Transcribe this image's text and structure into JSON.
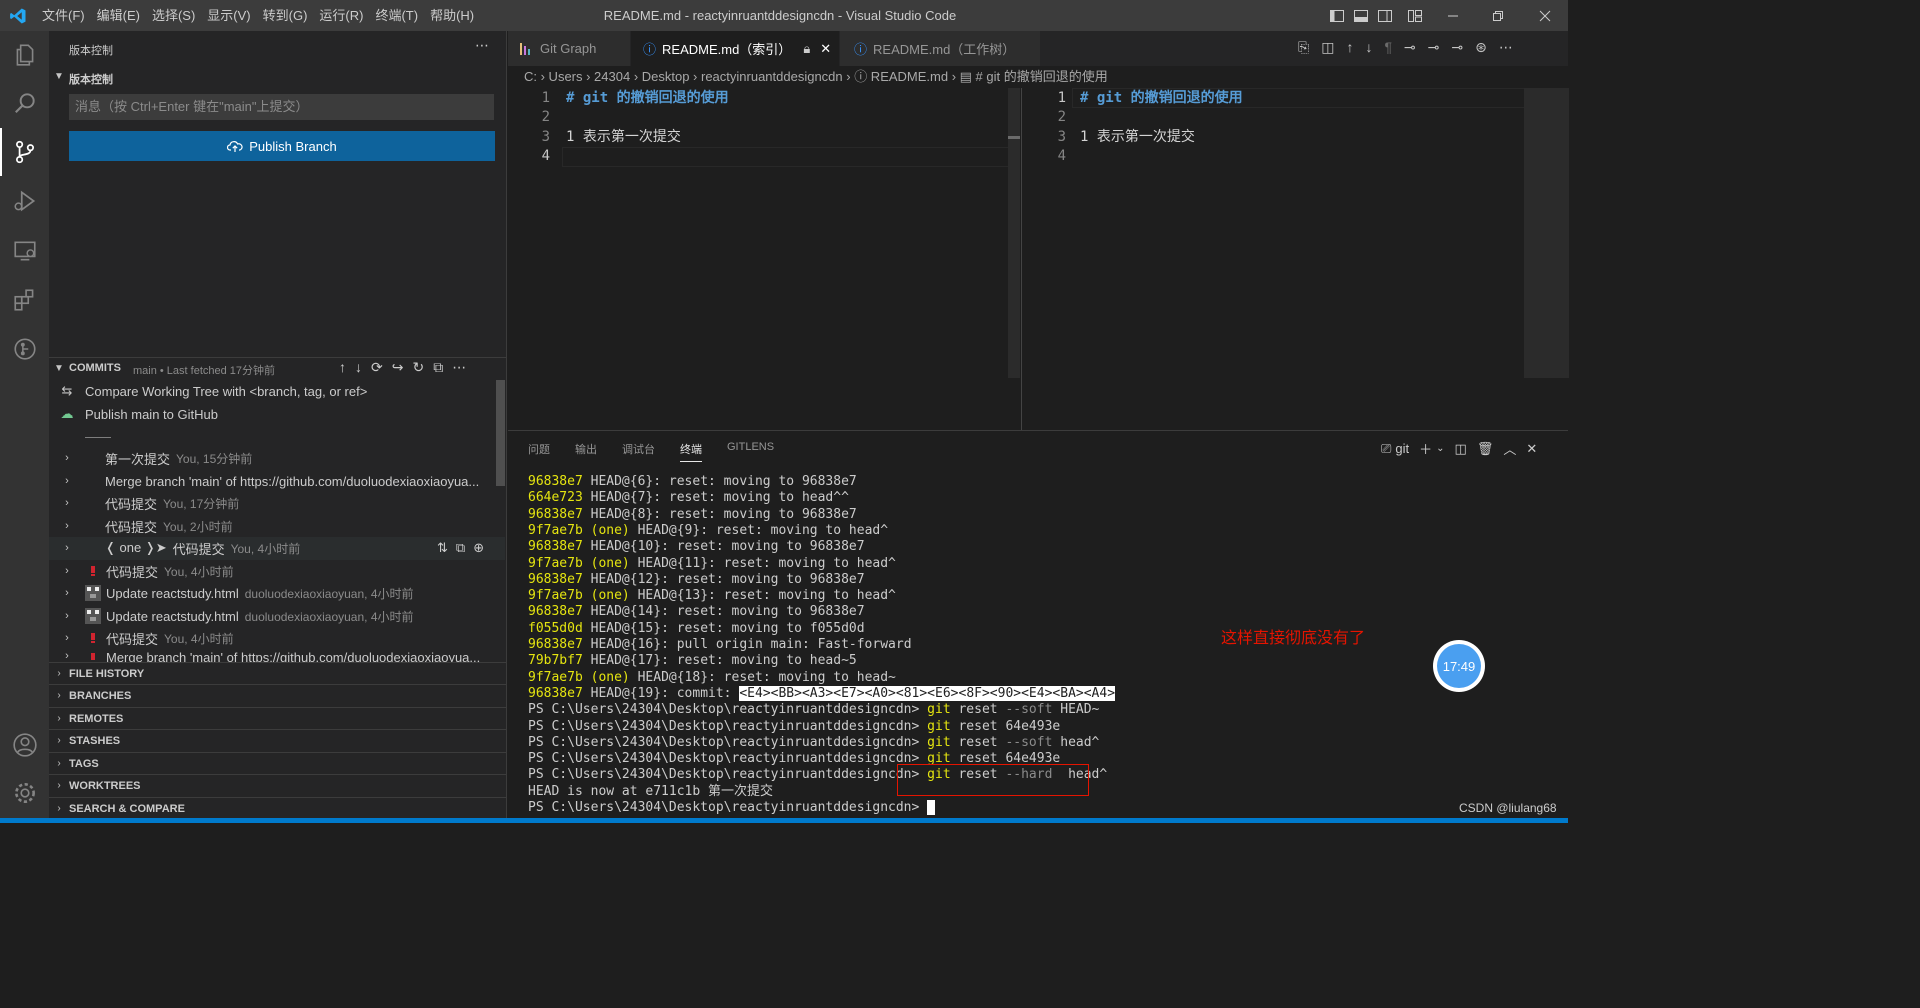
{
  "menu": [
    "文件(F)",
    "编辑(E)",
    "选择(S)",
    "显示(V)",
    "转到(G)",
    "运行(R)",
    "终端(T)",
    "帮助(H)"
  ],
  "window_title": "README.md - reactyinruantddesigncdn - Visual Studio Code",
  "sidebar": {
    "title": "版本控制",
    "section_title": "版本控制",
    "message_placeholder": "消息（按 Ctrl+Enter 键在\"main\"上提交）",
    "publish_label": "Publish Branch",
    "commits": {
      "header": "COMMITS",
      "subtitle": "main • Last fetched 17分钟前",
      "compare_label": "Compare Working Tree with <branch, tag, or ref>",
      "publish_main_label": "Publish main to GitHub",
      "divider": "——",
      "items": [
        {
          "label": "第一次提交",
          "meta": "You, 15分钟前",
          "avatar": "none"
        },
        {
          "label": "Merge branch 'main' of https://github.com/duoluodexiaoxiaoyua...",
          "meta": "",
          "avatar": "none"
        },
        {
          "label": "代码提交",
          "meta": "You, 17分钟前",
          "avatar": "none"
        },
        {
          "label": "代码提交",
          "meta": "You, 2小时前",
          "avatar": "none"
        },
        {
          "label": "代码提交",
          "meta": "You, 4小时前",
          "avatar": "none",
          "branch_tag": "❬ one ❭➤"
        },
        {
          "label": "代码提交",
          "meta": "You, 4小时前",
          "avatar": "red"
        },
        {
          "label": "Update reactstudy.html",
          "meta": "duoluodexiaoxiaoyuan, 4小时前",
          "avatar": "pixel"
        },
        {
          "label": "Update reactstudy.html",
          "meta": "duoluodexiaoxiaoyuan, 4小时前",
          "avatar": "pixel"
        },
        {
          "label": "代码提交",
          "meta": "You, 4小时前",
          "avatar": "red"
        },
        {
          "label": "Merge branch 'main' of https://github.com/duoluodexiaoxiaoyua...",
          "meta": "",
          "avatar": "red"
        }
      ]
    },
    "bottom_sections": [
      "FILE HISTORY",
      "BRANCHES",
      "REMOTES",
      "STASHES",
      "TAGS",
      "WORKTREES",
      "SEARCH & COMPARE"
    ]
  },
  "tabs": [
    {
      "label": "Git Graph"
    },
    {
      "label": "README.md（索引）"
    },
    {
      "label": "README.md（工作树）"
    }
  ],
  "breadcrumb": "C: › Users › 24304 › Desktop › reactyinruantddesigncdn › ⓘ README.md › ▤ # git 的撤销回退的使用",
  "editor_left": [
    {
      "n": "1",
      "text": "# git 的撤销回退的使用"
    },
    {
      "n": "2",
      "text": ""
    },
    {
      "n": "3",
      "text": "1 表示第一次提交"
    },
    {
      "n": "4",
      "text": ""
    }
  ],
  "editor_right": [
    {
      "n": "1",
      "text": "# git 的撤销回退的使用"
    },
    {
      "n": "2",
      "text": ""
    },
    {
      "n": "3",
      "text": "1 表示第一次提交"
    },
    {
      "n": "4",
      "text": ""
    }
  ],
  "panel": {
    "tabs": [
      "问题",
      "输出",
      "调试台",
      "终端",
      "GITLENS"
    ],
    "active_tab": "终端",
    "terminal_name": "git",
    "reflog": [
      {
        "hash": "96838e7",
        "branch": "",
        "rest": "HEAD@{6}: reset: moving to 96838e7"
      },
      {
        "hash": "664e723",
        "branch": "",
        "rest": "HEAD@{7}: reset: moving to head^^"
      },
      {
        "hash": "96838e7",
        "branch": "",
        "rest": "HEAD@{8}: reset: moving to 96838e7"
      },
      {
        "hash": "9f7ae7b",
        "branch": "(one)",
        "rest": "HEAD@{9}: reset: moving to head^"
      },
      {
        "hash": "96838e7",
        "branch": "",
        "rest": "HEAD@{10}: reset: moving to 96838e7"
      },
      {
        "hash": "9f7ae7b",
        "branch": "(one)",
        "rest": "HEAD@{11}: reset: moving to head^"
      },
      {
        "hash": "96838e7",
        "branch": "",
        "rest": "HEAD@{12}: reset: moving to 96838e7"
      },
      {
        "hash": "9f7ae7b",
        "branch": "(one)",
        "rest": "HEAD@{13}: reset: moving to head^"
      },
      {
        "hash": "96838e7",
        "branch": "",
        "rest": "HEAD@{14}: reset: moving to 96838e7"
      },
      {
        "hash": "f055d0d",
        "branch": "",
        "rest": "HEAD@{15}: reset: moving to f055d0d"
      },
      {
        "hash": "96838e7",
        "branch": "",
        "rest": "HEAD@{16}: pull origin main: Fast-forward"
      },
      {
        "hash": "79b7bf7",
        "branch": "",
        "rest": "HEAD@{17}: reset: moving to head~5"
      },
      {
        "hash": "9f7ae7b",
        "branch": "(one)",
        "rest": "HEAD@{18}: reset: moving to head~"
      },
      {
        "hash": "96838e7",
        "branch": "",
        "rest": "HEAD@{19}: commit: ",
        "selected": "<E4><BB><A3><E7><A0><81><E6><8F><90><E4><BA><A4>"
      }
    ],
    "prompt": "PS C:\\Users\\24304\\Desktop\\reactyinruantddesigncdn>",
    "commands": [
      {
        "git": " git",
        "sub": " reset",
        "flag": " --soft",
        "arg": " HEAD~"
      },
      {
        "git": " git",
        "sub": " reset",
        "flag": "",
        "arg": " 64e493e"
      },
      {
        "git": " git",
        "sub": " reset",
        "flag": " --soft",
        "arg": " head^"
      },
      {
        "git": " git",
        "sub": " reset",
        "flag": "",
        "arg": " 64e493e"
      },
      {
        "git": " git",
        "sub": " reset",
        "flag": " --hard",
        "arg": "  head^"
      }
    ],
    "output_line": "HEAD is now at e711c1b 第一次提交",
    "annotation": "这样直接彻底没有了",
    "clock": "17:49",
    "watermark": "CSDN @liulang68"
  },
  "colors": {
    "accent": "#007acc",
    "publish": "#0e639c",
    "hash_yellow": "#e5e510",
    "annotation_red": "#e51400",
    "heading_blue": "#569cd6"
  }
}
